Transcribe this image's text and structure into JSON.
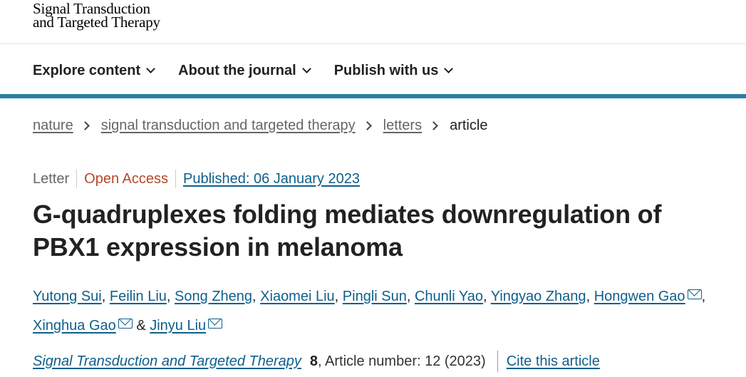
{
  "header": {
    "logo_line1": "Signal Transduction",
    "logo_line2": "and Targeted Therapy"
  },
  "nav": {
    "items": [
      {
        "label": "Explore content"
      },
      {
        "label": "About the journal"
      },
      {
        "label": "Publish with us"
      }
    ]
  },
  "breadcrumb": {
    "items": [
      "nature",
      "signal transduction and targeted therapy",
      "letters"
    ],
    "current": "article"
  },
  "article": {
    "type": "Letter",
    "access": "Open Access",
    "published": "Published: 06 January 2023",
    "title": "G-quadruplexes folding mediates downregulation of PBX1 expression in melanoma",
    "authors": [
      "Yutong Sui",
      "Feilin Liu",
      "Song Zheng",
      "Xiaomei Liu",
      "Pingli Sun",
      "Chunli Yao",
      "Yingyao Zhang",
      "Hongwen Gao",
      "Xinghua Gao",
      "Jinyu Liu"
    ],
    "separator_comma": ",",
    "separator_amp": "&",
    "citation": {
      "journal": "Signal Transduction and Targeted Therapy",
      "volume": "8",
      "rest": ", Article number: 12 (2023)",
      "cite_label": "Cite this article"
    }
  },
  "colors": {
    "accent_bar": "#2a7fa3",
    "link": "#0f5f8c",
    "open_access": "#b3492a"
  },
  "icons": {
    "chevron": "chevron-down-icon",
    "breadcrumb_sep": "chevron-right-icon",
    "mail": "mail-icon"
  }
}
